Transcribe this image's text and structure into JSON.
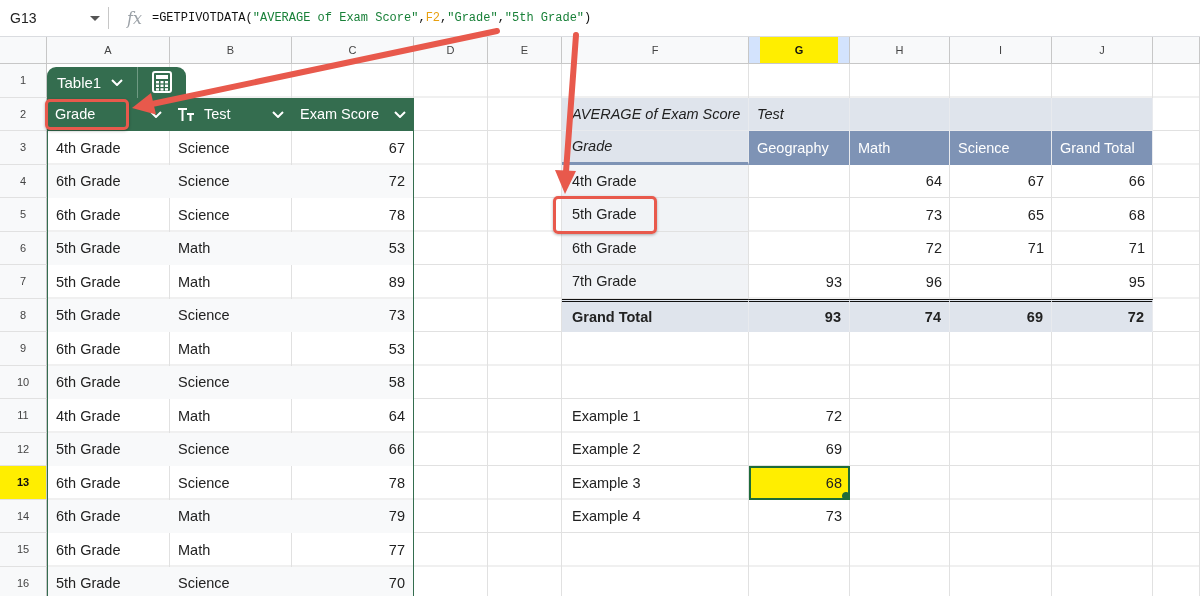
{
  "name_box": "G13",
  "fx_label": "fx",
  "formula": [
    {
      "kind": "plain",
      "text": "=GETPIVOTDATA("
    },
    {
      "kind": "string",
      "text": "\"AVERAGE of Exam Score\""
    },
    {
      "kind": "plain",
      "text": ","
    },
    {
      "kind": "ref",
      "text": "F2"
    },
    {
      "kind": "plain",
      "text": ","
    },
    {
      "kind": "string",
      "text": "\"Grade\""
    },
    {
      "kind": "plain",
      "text": ","
    },
    {
      "kind": "string",
      "text": "\"5th Grade\""
    },
    {
      "kind": "plain",
      "text": ")"
    }
  ],
  "columns": [
    {
      "label": "A",
      "selected": false,
      "highlighted": false
    },
    {
      "label": "B",
      "selected": false,
      "highlighted": false
    },
    {
      "label": "C",
      "selected": false,
      "highlighted": false
    },
    {
      "label": "D",
      "selected": false,
      "highlighted": false
    },
    {
      "label": "E",
      "selected": false,
      "highlighted": false
    },
    {
      "label": "F",
      "selected": false,
      "highlighted": false
    },
    {
      "label": "G",
      "selected": true,
      "highlighted": true
    },
    {
      "label": "H",
      "selected": false,
      "highlighted": false
    },
    {
      "label": "I",
      "selected": false,
      "highlighted": false
    },
    {
      "label": "J",
      "selected": false,
      "highlighted": false
    }
  ],
  "rows": [
    {
      "label": "1",
      "selected": false,
      "highlighted": false
    },
    {
      "label": "2",
      "selected": false,
      "highlighted": false
    },
    {
      "label": "3",
      "selected": false,
      "highlighted": false
    },
    {
      "label": "4",
      "selected": false,
      "highlighted": false
    },
    {
      "label": "5",
      "selected": false,
      "highlighted": false
    },
    {
      "label": "6",
      "selected": false,
      "highlighted": false
    },
    {
      "label": "7",
      "selected": false,
      "highlighted": false
    },
    {
      "label": "8",
      "selected": false,
      "highlighted": false
    },
    {
      "label": "9",
      "selected": false,
      "highlighted": false
    },
    {
      "label": "10",
      "selected": false,
      "highlighted": false
    },
    {
      "label": "11",
      "selected": false,
      "highlighted": false
    },
    {
      "label": "12",
      "selected": false,
      "highlighted": false
    },
    {
      "label": "13",
      "selected": true,
      "highlighted": true
    },
    {
      "label": "14",
      "selected": false,
      "highlighted": false
    },
    {
      "label": "15",
      "selected": false,
      "highlighted": false
    },
    {
      "label": "16",
      "selected": false,
      "highlighted": false
    }
  ],
  "table": {
    "name": "Table1",
    "columns": [
      {
        "label": "Grade",
        "kind": "category",
        "boxed": true
      },
      {
        "label": "Test",
        "kind": "text",
        "boxed": false
      },
      {
        "label": "Exam Score",
        "kind": "number",
        "boxed": false
      }
    ],
    "rows": [
      [
        "4th Grade",
        "Science",
        "67"
      ],
      [
        "6th Grade",
        "Science",
        "72"
      ],
      [
        "6th Grade",
        "Science",
        "78"
      ],
      [
        "5th Grade",
        "Math",
        "53"
      ],
      [
        "5th Grade",
        "Math",
        "89"
      ],
      [
        "5th Grade",
        "Science",
        "73"
      ],
      [
        "6th Grade",
        "Math",
        "53"
      ],
      [
        "6th Grade",
        "Science",
        "58"
      ],
      [
        "4th Grade",
        "Math",
        "64"
      ],
      [
        "5th Grade",
        "Science",
        "66"
      ],
      [
        "6th Grade",
        "Science",
        "78"
      ],
      [
        "6th Grade",
        "Math",
        "79"
      ],
      [
        "6th Grade",
        "Math",
        "77"
      ],
      [
        "5th Grade",
        "Science",
        "70"
      ]
    ]
  },
  "pivot": {
    "corner": "AVERAGE of Exam Score",
    "column_field": "Test",
    "row_field": "Grade",
    "columns": [
      "Geography",
      "Math",
      "Science",
      "Grand Total"
    ],
    "rows": [
      {
        "label": "4th Grade",
        "math": "64",
        "science": "67",
        "grand_total": "66",
        "boxed": false
      },
      {
        "label": "5th Grade",
        "math": "73",
        "science": "65",
        "grand_total": "68",
        "boxed": true
      },
      {
        "label": "6th Grade",
        "math": "72",
        "science": "71",
        "grand_total": "71",
        "boxed": false
      },
      {
        "label": "7th Grade",
        "geography": "93",
        "math": "96",
        "grand_total": "95",
        "boxed": false
      }
    ],
    "total": {
      "label": "Grand Total",
      "geography": "93",
      "math": "74",
      "science": "69",
      "grand_total": "72"
    }
  },
  "examples": [
    {
      "label": "Example 1",
      "value": "72",
      "selected": false,
      "highlighted": false
    },
    {
      "label": "Example 2",
      "value": "69",
      "selected": false,
      "highlighted": false
    },
    {
      "label": "Example 3",
      "value": "68",
      "selected": true,
      "highlighted": true
    },
    {
      "label": "Example 4",
      "value": "73",
      "selected": false,
      "highlighted": false
    }
  ]
}
